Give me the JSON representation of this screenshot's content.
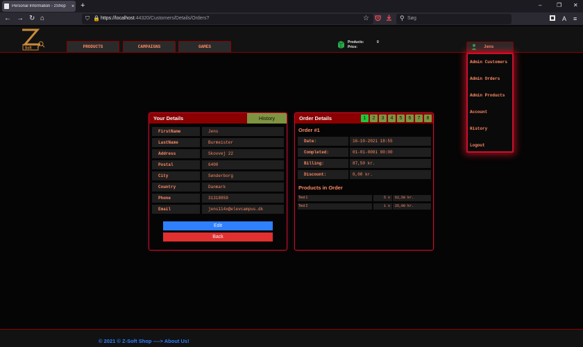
{
  "browser": {
    "tab_title": "Personal Information - zShop",
    "tab_close": "×",
    "new_tab": "+",
    "back": "←",
    "forward": "→",
    "reload": "↻",
    "home": "⌂",
    "shield": "⛉",
    "lock": "🔒",
    "url_host": "https://localhost",
    "url_path": ":44320/Customers/Details/Orders?",
    "bookmark": "☆",
    "search_icon": "⚲",
    "search_placeholder": "Søg",
    "minimize": "–",
    "restore": "❐",
    "close": "✕",
    "menu": "≡",
    "reader": "A"
  },
  "header": {
    "logo_alt": "Z-Soft",
    "nav": [
      "PRODUCTS",
      "CAMPAIGNS",
      "GAMES"
    ],
    "cart": {
      "products_label": "Products:",
      "products_value": "0",
      "price_label": "Price:"
    },
    "user_name": "Jens"
  },
  "dropdown": {
    "items": [
      "Admin Customers",
      "Admin Orders",
      "Admin Products",
      "Account",
      "History",
      "Logout"
    ]
  },
  "details_panel": {
    "title": "Your Details",
    "history_tab": "History",
    "fields": [
      {
        "key": "FirstName",
        "value": "Jens"
      },
      {
        "key": "LastName",
        "value": "Burmeister"
      },
      {
        "key": "Address",
        "value": "Skovvej 22"
      },
      {
        "key": "Postal",
        "value": "6400"
      },
      {
        "key": "City",
        "value": "Sønderborg"
      },
      {
        "key": "Country",
        "value": "Danmark"
      },
      {
        "key": "Phone",
        "value": "31318859"
      },
      {
        "key": "Email",
        "value": "jens114x@elevcampus.dk"
      }
    ],
    "edit_label": "Edit",
    "back_label": "Back"
  },
  "order_panel": {
    "title": "Order Details",
    "pages": [
      "1",
      "2",
      "3",
      "4",
      "5",
      "6",
      "7",
      "8"
    ],
    "active_page": "1",
    "order_number": "Order #1",
    "fields": [
      {
        "key": "Date:",
        "value": "16-10-2021 18:55"
      },
      {
        "key": "Completed:",
        "value": "01-01-0001 00:00"
      },
      {
        "key": "Billing:",
        "value": "87,50 kr."
      },
      {
        "key": "Discount:",
        "value": "0,00 kr."
      }
    ],
    "products_title": "Products in Order",
    "products": [
      {
        "name": "Test 1",
        "qty": "5 x",
        "price": "62,50 kr."
      },
      {
        "name": "Test 2",
        "qty": "1 x",
        "price": "25,00 kr."
      }
    ]
  },
  "footer": {
    "text": "© 2021 © Z-Soft Shop ----> About Us!"
  },
  "colors": {
    "accent_red": "#c8102e",
    "header_red": "#8b0000",
    "label_orange": "#ff8a65",
    "link_blue": "#2f7fff",
    "active_green": "#21c63a"
  }
}
